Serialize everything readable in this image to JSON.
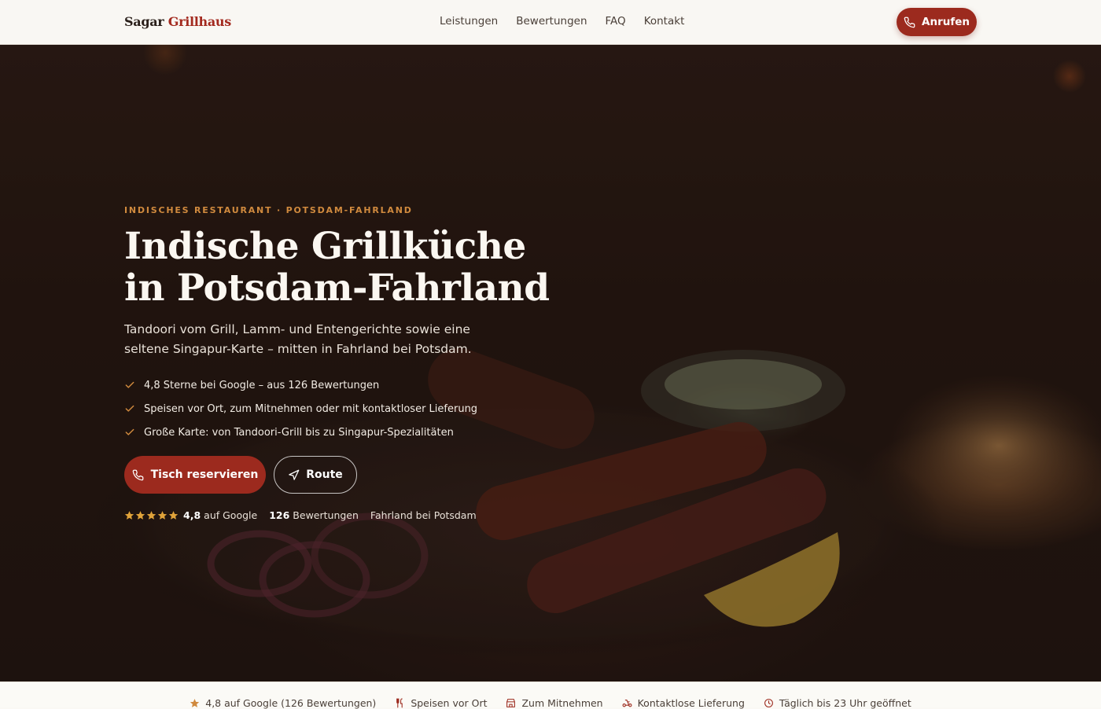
{
  "header": {
    "logo_part1": "Sagar",
    "logo_part2": "Grillhaus",
    "nav": [
      "Leistungen",
      "Bewertungen",
      "FAQ",
      "Kontakt"
    ],
    "call_button": "Anrufen"
  },
  "hero": {
    "eyebrow": "INDISCHES RESTAURANT · POTSDAM-FAHRLAND",
    "headline_line1": "Indische Grillküche",
    "headline_line2": "in Potsdam-Fahrland",
    "lead": "Tandoori vom Grill, Lamm- und Entengerichte sowie eine seltene Singapur-Karte – mitten in Fahrland bei Potsdam.",
    "checks": [
      "4,8 Sterne bei Google – aus 126 Bewertungen",
      "Speisen vor Ort, zum Mitnehmen oder mit kontaktloser Lieferung",
      "Große Karte: von Tandoori-Grill bis zu Singapur-Spezialitäten"
    ],
    "primary_button": "Tisch reservieren",
    "secondary_button": "Route",
    "rating": {
      "stars": 5,
      "value": "4,8",
      "value_suffix": "auf Google",
      "count": "126",
      "count_suffix": "Bewertungen",
      "location": "Fahrland bei Potsdam"
    }
  },
  "strip": [
    {
      "icon": "star-icon",
      "label": "4,8 auf Google (126 Bewertungen)"
    },
    {
      "icon": "utensils-icon",
      "label": "Speisen vor Ort"
    },
    {
      "icon": "store-icon",
      "label": "Zum Mitnehmen"
    },
    {
      "icon": "scooter-icon",
      "label": "Kontaktlose Lieferung"
    },
    {
      "icon": "clock-icon",
      "label": "Täglich bis 23 Uhr geöffnet"
    }
  ],
  "colors": {
    "brand": "#9c2a1e",
    "accent": "#d08a3e",
    "star": "#e0a33a",
    "hero_bg": "#22150f"
  }
}
